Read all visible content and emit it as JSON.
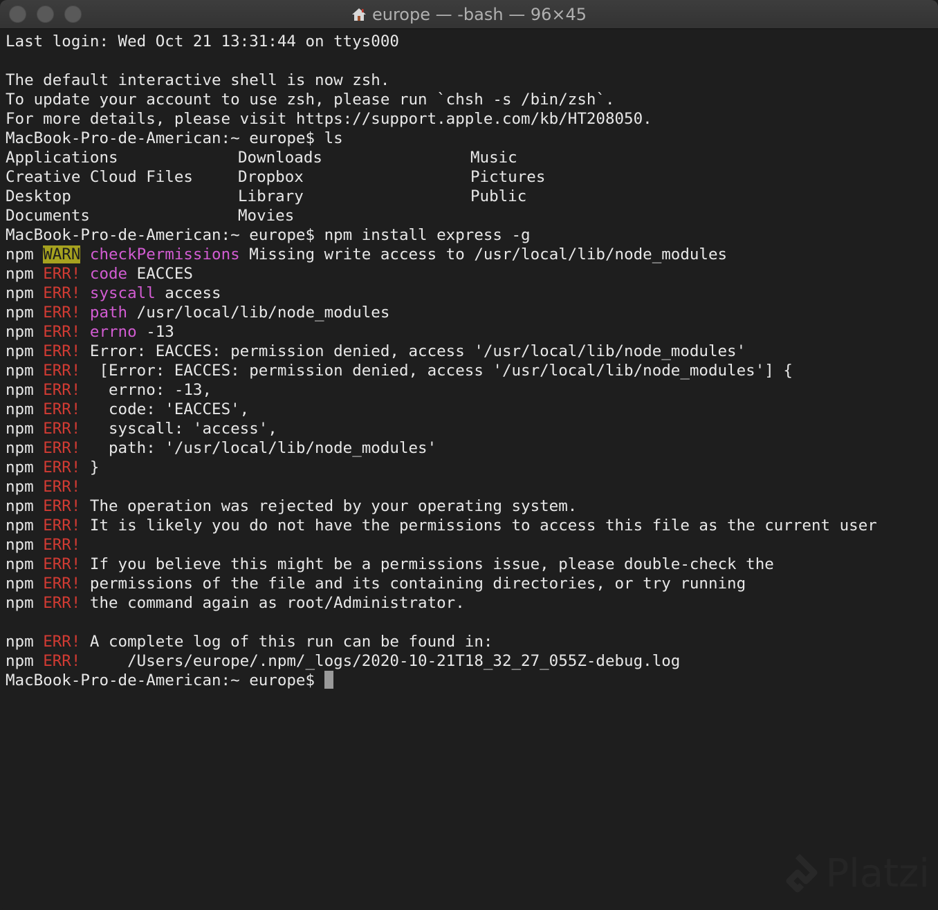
{
  "window": {
    "title": "europe — -bash — 96×45"
  },
  "terminal": {
    "last_login": "Last login: Wed Oct 21 13:31:44 on ttys000",
    "shell_notice": [
      "The default interactive shell is now zsh.",
      "To update your account to use zsh, please run `chsh -s /bin/zsh`.",
      "For more details, please visit https://support.apple.com/kb/HT208050."
    ],
    "prompt": "MacBook-Pro-de-American:~ europe$ ",
    "cmd_ls": "ls",
    "ls_rows": [
      [
        "Applications",
        "Downloads",
        "Music"
      ],
      [
        "Creative Cloud Files",
        "Dropbox",
        "Pictures"
      ],
      [
        "Desktop",
        "Library",
        "Public"
      ],
      [
        "Documents",
        "Movies",
        ""
      ]
    ],
    "cmd_npm": "npm install express -g",
    "npm_prefix": "npm",
    "warn_tag": "WARN",
    "err_tag": "ERR!",
    "warn_line": {
      "key": "checkPermissions",
      "text": " Missing write access to /usr/local/lib/node_modules"
    },
    "kv_lines": [
      {
        "key": "code",
        "text": " EACCES"
      },
      {
        "key": "syscall",
        "text": " access"
      },
      {
        "key": "path",
        "text": " /usr/local/lib/node_modules"
      },
      {
        "key": "errno",
        "text": " -13"
      }
    ],
    "err_lines": [
      "Error: EACCES: permission denied, access '/usr/local/lib/node_modules'",
      " [Error: EACCES: permission denied, access '/usr/local/lib/node_modules'] {",
      "  errno: -13,",
      "  code: 'EACCES',",
      "  syscall: 'access',",
      "  path: '/usr/local/lib/node_modules'",
      "}",
      "",
      "The operation was rejected by your operating system.",
      "It is likely you do not have the permissions to access this file as the current user",
      "",
      "If you believe this might be a permissions issue, please double-check the",
      "permissions of the file and its containing directories, or try running",
      "the command again as root/Administrator."
    ],
    "log_lines": [
      "A complete log of this run can be found in:",
      "    /Users/europe/.npm/_logs/2020-10-21T18_32_27_055Z-debug.log"
    ]
  },
  "watermark": {
    "text": "Platzi"
  },
  "colors": {
    "background": "#1e1e1e",
    "foreground": "#e8e8e8",
    "warn_bg": "#a6a21f",
    "err": "#d13b33",
    "keyword": "#d25cd2"
  }
}
